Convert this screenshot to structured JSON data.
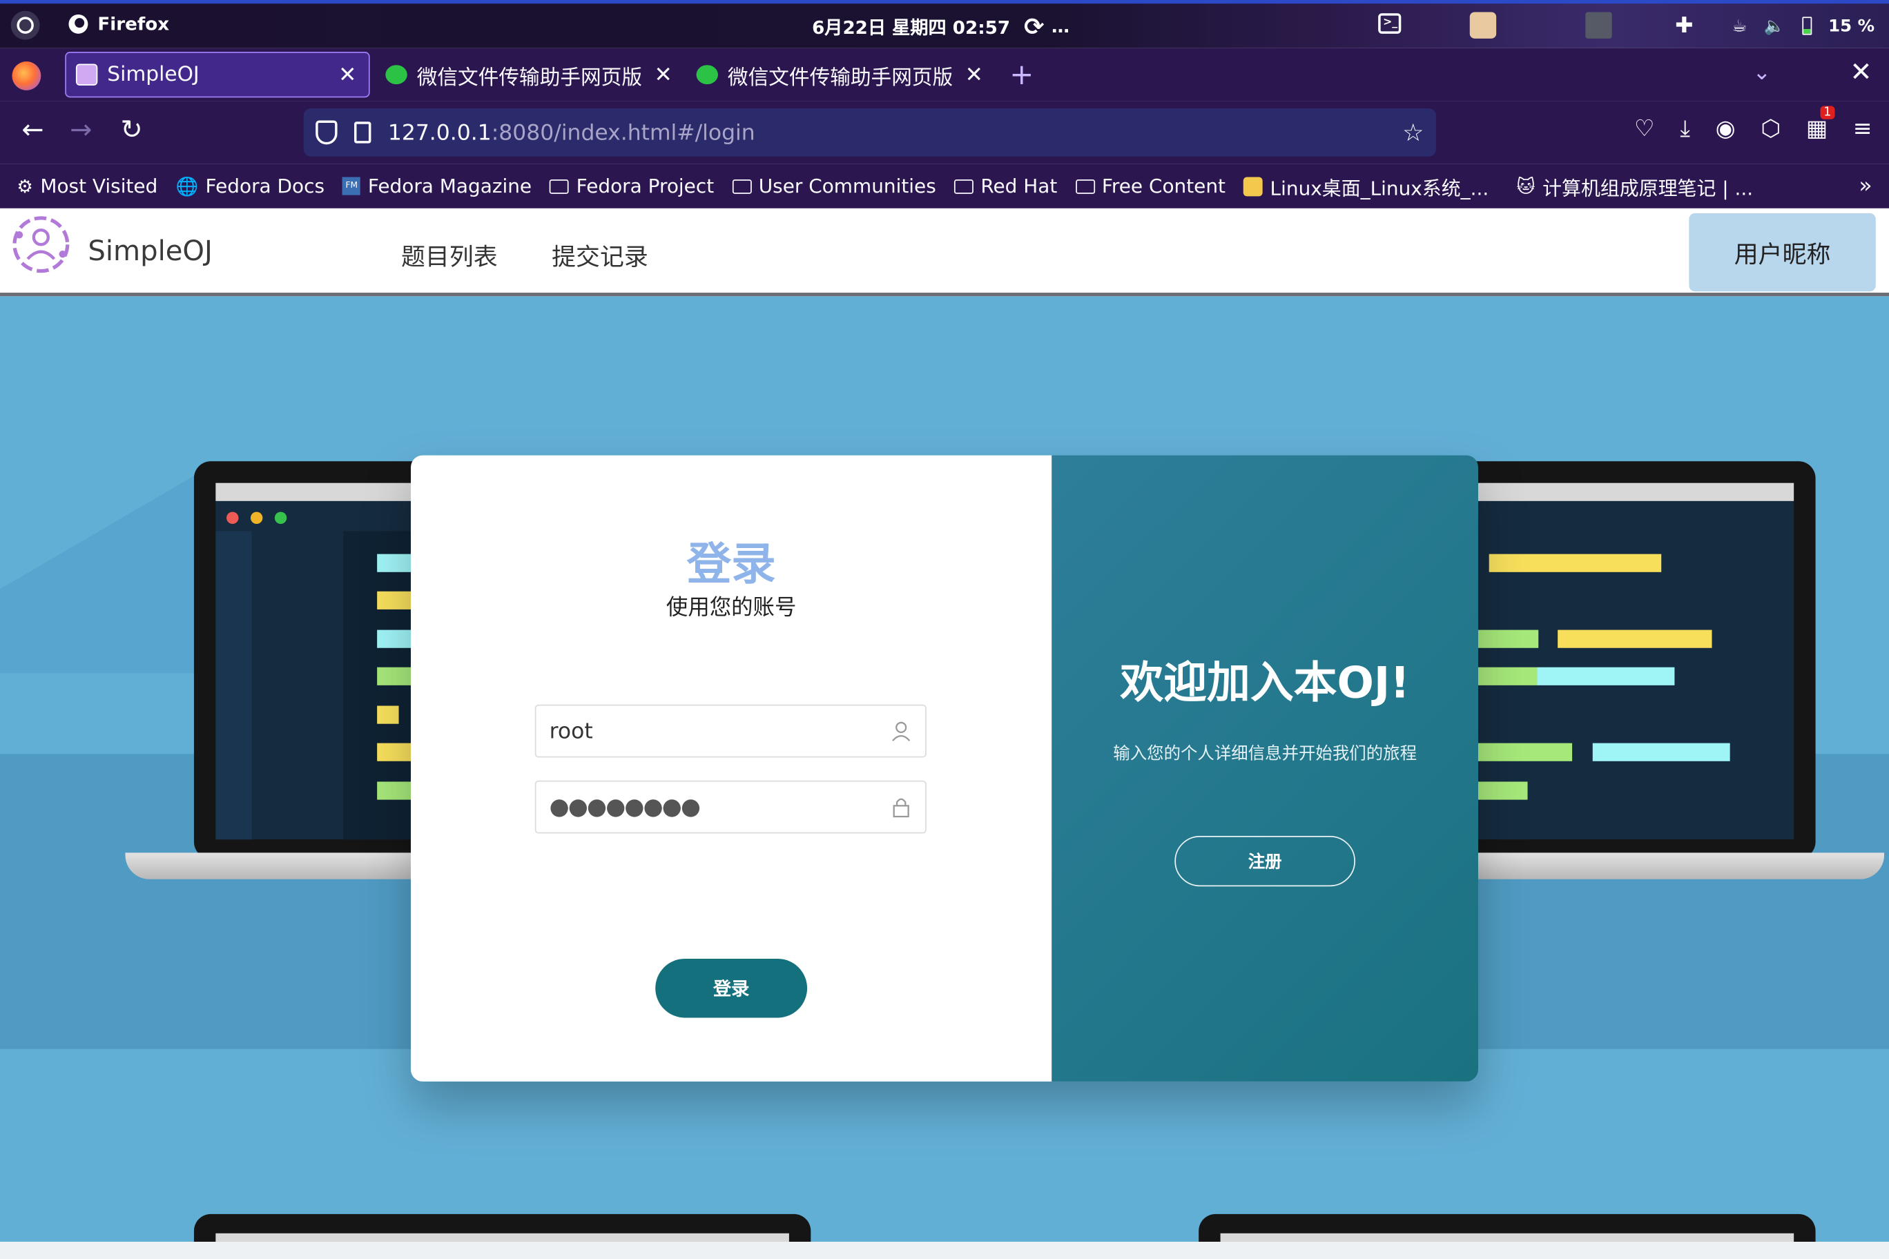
{
  "gnome": {
    "app_name": "Firefox",
    "clock": "6月22日 星期四 02:57",
    "loading": "…",
    "battery": "15 %"
  },
  "tabs": [
    {
      "title": "SimpleOJ",
      "active": true
    },
    {
      "title": "微信文件传输助手网页版",
      "active": false
    },
    {
      "title": "微信文件传输助手网页版",
      "active": false
    }
  ],
  "url": {
    "host": "127.0.0.1",
    "path": ":8080/index.html#/login"
  },
  "toolbar": {
    "extension_badge": "1"
  },
  "bookmarks": [
    {
      "label": "Most Visited",
      "icon": "gear-icon"
    },
    {
      "label": "Fedora Docs",
      "icon": "globe-icon"
    },
    {
      "label": "Fedora Magazine",
      "icon": "fm-icon"
    },
    {
      "label": "Fedora Project",
      "icon": "folder-icon"
    },
    {
      "label": "User Communities",
      "icon": "folder-icon"
    },
    {
      "label": "Red Hat",
      "icon": "folder-icon"
    },
    {
      "label": "Free Content",
      "icon": "folder-icon"
    },
    {
      "label": "Linux桌面_Linux系统_...",
      "icon": "tux-icon"
    },
    {
      "label": "计算机组成原理笔记 | ...",
      "icon": "cat-icon"
    }
  ],
  "oj": {
    "brand": "SimpleOJ",
    "menu": [
      "题目列表",
      "提交记录"
    ],
    "user": "用户昵称"
  },
  "login": {
    "title": "登录",
    "subtitle": "使用您的账号",
    "username": "root",
    "password_mask": "●●●●●●●●",
    "submit": "登录"
  },
  "welcome": {
    "title": "欢迎加入本OJ!",
    "text": "输入您的个人详细信息并开始我们的旅程",
    "register": "注册"
  },
  "colors": {
    "accent": "#14707c",
    "title_blue": "#8fb4ea",
    "page_bg": "#62afd6",
    "panel_gradient_start": "#2e7e9a",
    "panel_gradient_end": "#1a7280",
    "user_button": "#b8d6ec"
  }
}
